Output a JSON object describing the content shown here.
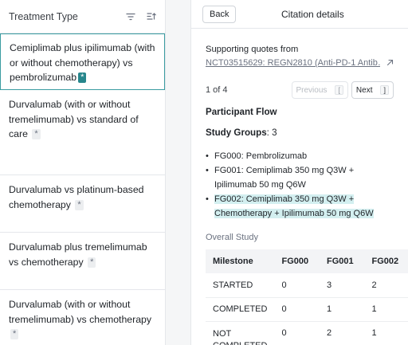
{
  "left": {
    "header": "Treatment Type",
    "rows": [
      {
        "text": "Cemiplimab plus ipilimumab (with or without chemotherapy) vs pembrolizumab",
        "badge": "*"
      },
      {
        "text": "Durvalumab (with or without tremelimumab) vs standard of care",
        "badge": "*"
      },
      {
        "text": "Durvalumab vs platinum-based chemotherapy",
        "badge": "*"
      },
      {
        "text": "Durvalumab plus tremelimumab vs chemotherapy",
        "badge": "*"
      },
      {
        "text": "Durvalumab (with or without tremelimumab) vs chemotherapy",
        "badge": "*"
      }
    ]
  },
  "right": {
    "back": "Back",
    "title": "Citation details",
    "supporting": "Supporting quotes from",
    "link": "NCT03515629: REGN2810 (Anti-PD-1 Antib…",
    "pager": {
      "count": "1 of 4",
      "prev": "Previous",
      "prev_key": "[",
      "next": "Next",
      "next_key": "]"
    },
    "section": "Participant Flow",
    "groups_label": "Study Groups",
    "groups_value": ": 3",
    "groups": [
      "FG000: Pembrolizumab",
      "FG001: Cemiplimab 350 mg Q3W + Ipilimumab 50 mg Q6W",
      "FG002: Cemiplimab 350 mg Q3W + Chemotherapy + Ipilimumab 50 mg Q6W"
    ],
    "overall": "Overall Study",
    "table": {
      "headers": [
        "Milestone",
        "FG000",
        "FG001",
        "FG002"
      ],
      "rows": [
        [
          "STARTED",
          "0",
          "3",
          "2"
        ],
        [
          "COMPLETED",
          "0",
          "1",
          "1"
        ],
        [
          "NOT COMPLETED",
          "0",
          "2",
          "1"
        ]
      ]
    }
  }
}
